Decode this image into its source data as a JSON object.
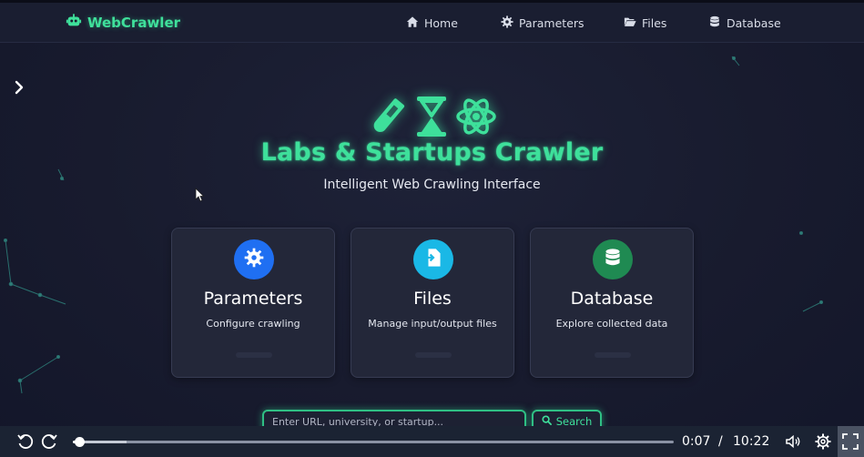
{
  "navbar": {
    "brand": "WebCrawler",
    "items": [
      {
        "label": "Home",
        "icon": "home-icon"
      },
      {
        "label": "Parameters",
        "icon": "gear-icon"
      },
      {
        "label": "Files",
        "icon": "folder-open-icon"
      },
      {
        "label": "Database",
        "icon": "database-icon"
      }
    ]
  },
  "hero": {
    "icons": [
      "flask-icon",
      "hourglass-icon",
      "atom-icon"
    ],
    "title": "Labs & Startups Crawler",
    "subtitle": "Intelligent Web Crawling Interface"
  },
  "cards": [
    {
      "title": "Parameters",
      "description": "Configure crawling",
      "icon": "gear-icon",
      "color": "#1f6ff2"
    },
    {
      "title": "Files",
      "description": "Manage input/output files",
      "icon": "file-import-icon",
      "color": "#1ab8e6"
    },
    {
      "title": "Database",
      "description": "Explore collected data",
      "icon": "database-icon",
      "color": "#1f8a52"
    }
  ],
  "search": {
    "placeholder": "Enter URL, university, or startup...",
    "button_label": "Search"
  },
  "player": {
    "current_time": "0:07",
    "separator": "/",
    "duration": "10:22",
    "progress": 0.011,
    "buffered": 0.09
  },
  "colors": {
    "accent": "#3ee09b",
    "background": "#181b2e",
    "card": "#232739"
  }
}
